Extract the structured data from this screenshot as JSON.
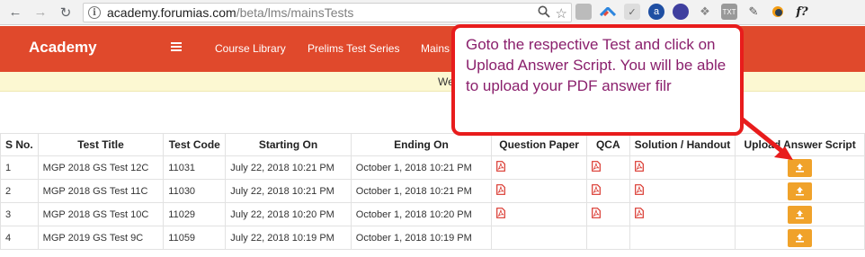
{
  "browser": {
    "url_host": "academy.forumias.com",
    "url_path": "/beta/lms/mainsTests",
    "ext_last": "f?"
  },
  "header": {
    "brand": "Academy",
    "nav": [
      "Course Library",
      "Prelims Test Series",
      "Mains"
    ]
  },
  "notice": {
    "text": "We"
  },
  "table": {
    "headers": [
      "S No.",
      "Test Title",
      "Test Code",
      "Starting On",
      "Ending On",
      "Question Paper",
      "QCA",
      "Solution / Handout",
      "Upload Answer Script"
    ],
    "rows": [
      {
        "sno": "1",
        "title": "MGP 2018 GS Test 12C",
        "code": "11031",
        "start": "July 22, 2018 10:21 PM",
        "end": "October 1, 2018 10:21 PM",
        "qp": true,
        "qca": true,
        "sol": true
      },
      {
        "sno": "2",
        "title": "MGP 2018 GS Test 11C",
        "code": "11030",
        "start": "July 22, 2018 10:21 PM",
        "end": "October 1, 2018 10:21 PM",
        "qp": true,
        "qca": true,
        "sol": true
      },
      {
        "sno": "3",
        "title": "MGP 2018 GS Test 10C",
        "code": "11029",
        "start": "July 22, 2018 10:20 PM",
        "end": "October 1, 2018 10:20 PM",
        "qp": true,
        "qca": true,
        "sol": true
      },
      {
        "sno": "4",
        "title": "MGP 2019 GS Test 9C",
        "code": "11059",
        "start": "July 22, 2018 10:19 PM",
        "end": "October 1, 2018 10:19 PM",
        "qp": false,
        "qca": false,
        "sol": false
      }
    ]
  },
  "callout": {
    "text": "Goto the respective Test and click on Upload Answer Script. You will be able to upload your PDF answer filr"
  },
  "colors": {
    "header_bg": "#e0492c",
    "upload_btn": "#f0a22a",
    "callout_border": "#e81c1c",
    "callout_text": "#8a1f6c",
    "pdf_icon": "#d9342b"
  }
}
